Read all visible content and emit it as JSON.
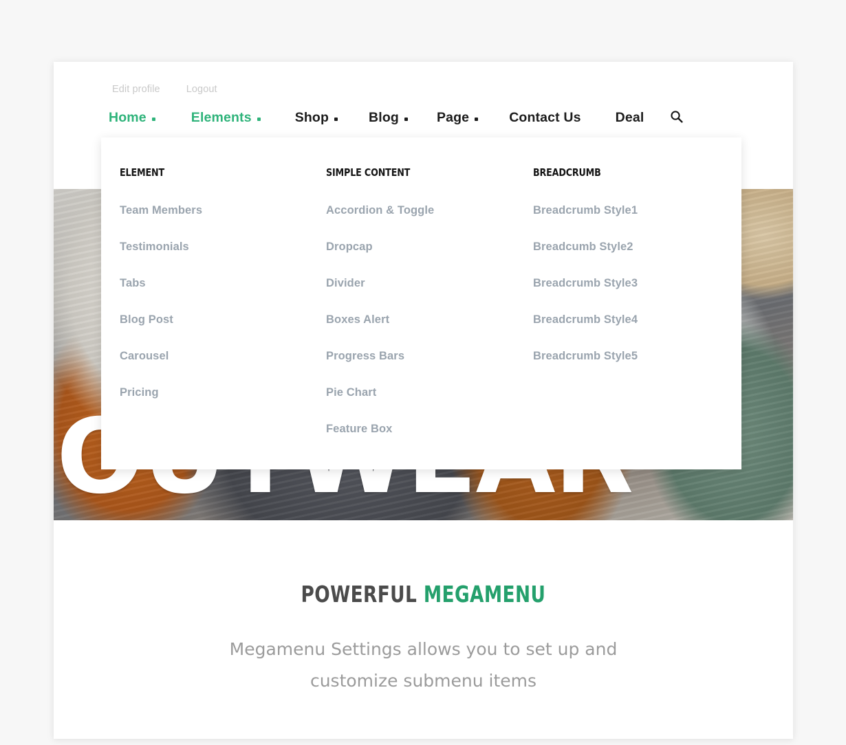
{
  "theme": {
    "accent_green": "#2eb37a",
    "caption_green": "#24a06c",
    "page_background": "#f7f7f7",
    "card_background": "#ffffff",
    "nav_text": "#1c1c1c",
    "muted_link": "#9aa4ae",
    "utility_link": "#c9c9c9"
  },
  "top_bar": {
    "links": [
      {
        "label": "Edit profile"
      },
      {
        "label": "Logout"
      }
    ]
  },
  "main_nav": {
    "items": [
      {
        "label": "Home",
        "has_caret": true,
        "active": true
      },
      {
        "label": "Elements",
        "has_caret": true,
        "active": true
      },
      {
        "label": "Shop",
        "has_caret": true,
        "active": false
      },
      {
        "label": "Blog",
        "has_caret": true,
        "active": false
      },
      {
        "label": "Page",
        "has_caret": true,
        "active": false
      },
      {
        "label": "Contact Us",
        "has_caret": false,
        "active": false
      },
      {
        "label": "Deal",
        "has_caret": false,
        "active": false
      }
    ],
    "search_icon": "search-icon"
  },
  "mega_menu": {
    "columns": [
      {
        "title": "ELEMENT",
        "links": [
          {
            "label": "Team Members"
          },
          {
            "label": "Testimonials"
          },
          {
            "label": "Tabs"
          },
          {
            "label": "Blog Post"
          },
          {
            "label": "Carousel"
          },
          {
            "label": "Pricing"
          }
        ]
      },
      {
        "title": "SIMPLE CONTENT",
        "links": [
          {
            "label": "Accordion & Toggle"
          },
          {
            "label": "Dropcap"
          },
          {
            "label": "Divider"
          },
          {
            "label": "Boxes Alert"
          },
          {
            "label": "Progress Bars"
          },
          {
            "label": "Pie Chart"
          },
          {
            "label": "Feature Box"
          }
        ]
      },
      {
        "title": "BREADCRUMB",
        "links": [
          {
            "label": "Breadcrumb Style1"
          },
          {
            "label": "Breadcumb Style2"
          },
          {
            "label": "Breadcrumb Style3"
          },
          {
            "label": "Breadcrumb Style4"
          },
          {
            "label": "Breadcrumb Style5"
          }
        ]
      }
    ]
  },
  "hero": {
    "headline": "OUTWEAR",
    "photo_alt": "sneakers-photo"
  },
  "caption": {
    "title_dark": "POWERFUL",
    "title_accent": "MEGAMENU",
    "subtitle_line1": "Megamenu Settings allows you to set up and",
    "subtitle_line2": "customize submenu items"
  }
}
